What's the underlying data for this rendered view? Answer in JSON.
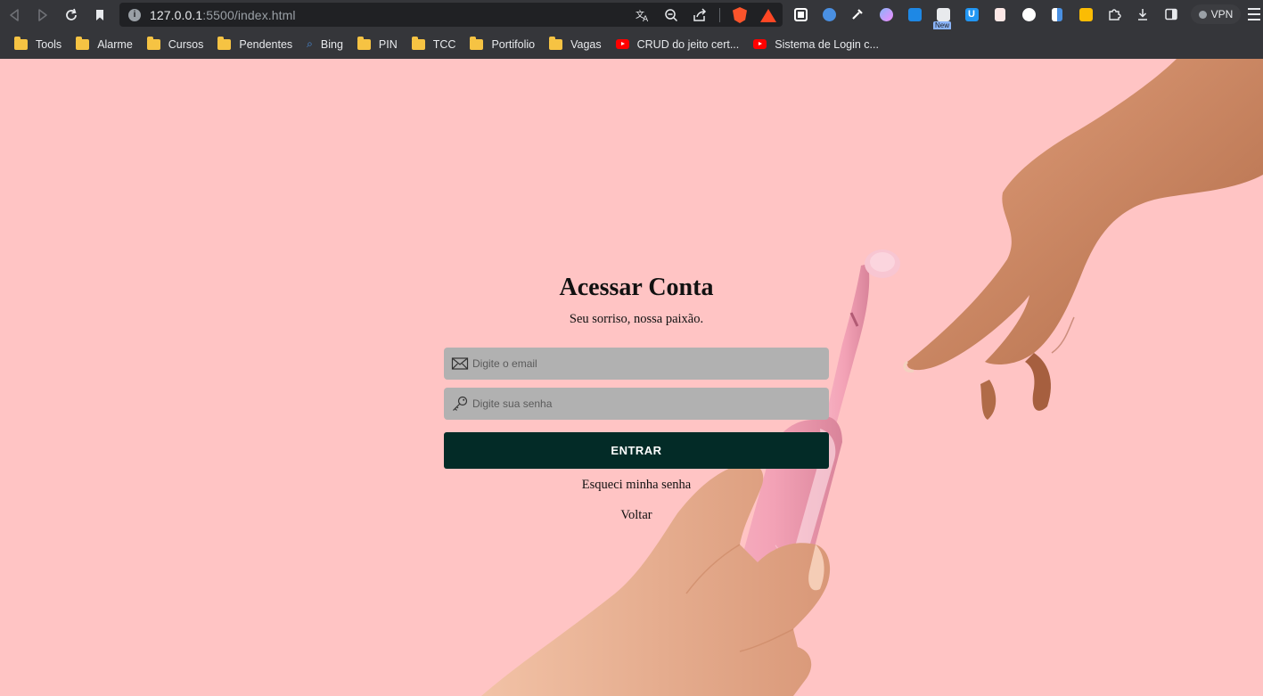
{
  "browser": {
    "url_host": "127.0.0.1",
    "url_path": ":5500/index.html",
    "extension_badge": "New",
    "vpn_label": "VPN"
  },
  "bookmarks": [
    {
      "label": "Tools",
      "icon": "folder-icon"
    },
    {
      "label": "Alarme",
      "icon": "folder-icon"
    },
    {
      "label": "Cursos",
      "icon": "folder-icon"
    },
    {
      "label": "Pendentes",
      "icon": "folder-icon"
    },
    {
      "label": "Bing",
      "icon": "search-icon"
    },
    {
      "label": "PIN",
      "icon": "folder-icon"
    },
    {
      "label": "TCC",
      "icon": "folder-icon"
    },
    {
      "label": "Portifolio",
      "icon": "folder-icon"
    },
    {
      "label": "Vagas",
      "icon": "folder-icon"
    },
    {
      "label": "CRUD do jeito cert...",
      "icon": "youtube-icon"
    },
    {
      "label": "Sistema de Login c...",
      "icon": "youtube-icon"
    }
  ],
  "login": {
    "title": "Acessar Conta",
    "subtitle": "Seu sorriso, nossa paixão.",
    "email_placeholder": "Digite o email",
    "password_placeholder": "Digite sua senha",
    "submit_label": "ENTRAR",
    "forgot_label": "Esqueci minha senha",
    "back_label": "Voltar"
  },
  "colors": {
    "page_background": "#ffc4c4",
    "button_background": "#032b27",
    "field_background": "#b1b1b1"
  }
}
